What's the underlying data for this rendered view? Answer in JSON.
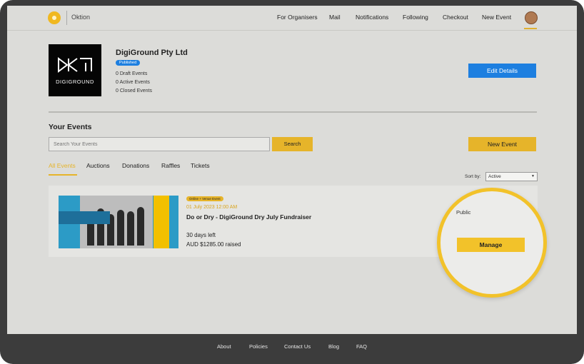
{
  "header": {
    "brand": "Oktion",
    "nav": [
      "For Organisers",
      "Mail",
      "Notifications",
      "Following",
      "Checkout",
      "New Event"
    ]
  },
  "org": {
    "logo_text": "DIGIGROUND",
    "name": "DigiGround Pty Ltd",
    "status_badge": "Published",
    "stats": [
      "0 Draft Events",
      "0 Active Events",
      "0 Closed Events"
    ],
    "edit_button": "Edit Details"
  },
  "events": {
    "heading": "Your Events",
    "search_placeholder": "Search Your Events",
    "search_button": "Search",
    "new_event_button": "New Event",
    "tabs": [
      "All Events",
      "Auctions",
      "Donations",
      "Raffles",
      "Tickets"
    ],
    "sort_label": "Sort by:",
    "sort_value": "Active",
    "card": {
      "tag": "Online + Venue Event",
      "date": "01 July 2023 12:00 AM",
      "title": "Do or Dry - DigiGround Dry July Fundraiser",
      "days_left": "30 days left",
      "raised_label": "AUD $1285.00 raised",
      "visibility": "Public",
      "manage_button": "Manage"
    }
  },
  "footer": {
    "links": [
      "About",
      "Policies",
      "Contact Us",
      "Blog",
      "FAQ"
    ]
  },
  "colors": {
    "accent": "#e6b42a",
    "primary": "#1d7fe0",
    "background": "#dcdcd9"
  }
}
